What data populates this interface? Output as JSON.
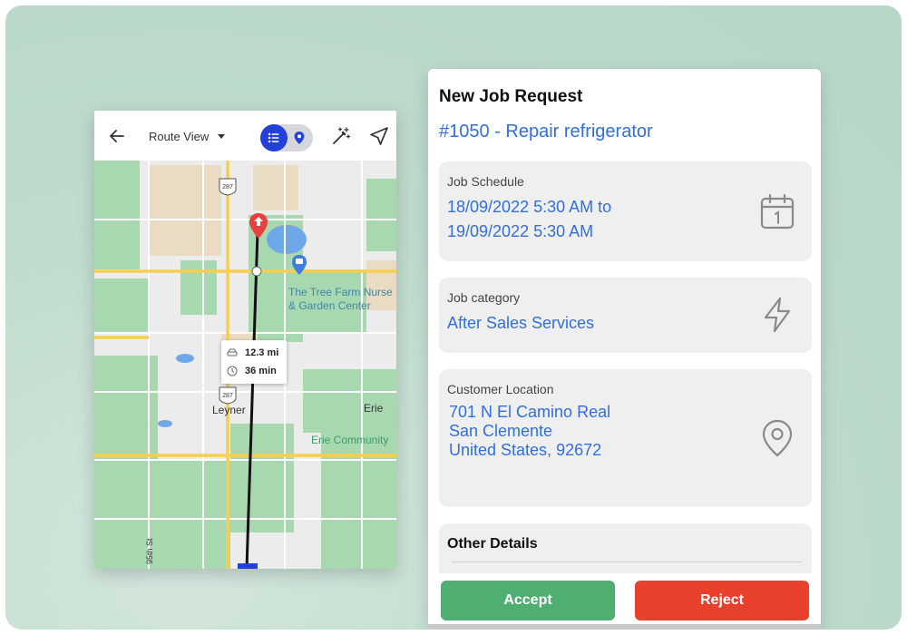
{
  "map_card": {
    "view_select": "Route View",
    "map": {
      "shield_top": "287",
      "shield_mid": "287",
      "poi_name_line1": "The Tree Farm Nurse",
      "poi_name_line2": "& Garden Center",
      "town_leyner": "Leyner",
      "town_erie": "Erie",
      "poi_erie": "Erie Community",
      "street_label": "95th St",
      "route_distance": "12.3 mi",
      "route_time": "36 min"
    }
  },
  "job_panel": {
    "title": "New Job Request",
    "job_number": "#1050 - Repair refrigerator",
    "schedule": {
      "label": "Job Schedule",
      "line1": "18/09/2022 5:30 AM to",
      "line2": "19/09/2022 5:30 AM",
      "icon": "calendar-icon"
    },
    "category": {
      "label": "Job category",
      "value": "After Sales Services",
      "icon": "lightning-icon"
    },
    "location": {
      "label": "Customer Location",
      "line1": "701 N El Camino Real",
      "line2": "San Clemente",
      "line3": "United States, 92672",
      "icon": "location-pin-icon"
    },
    "other_details": "Other Details",
    "accept_label": "Accept",
    "reject_label": "Reject"
  },
  "colors": {
    "background": "#bfdbcd",
    "accent_blue": "#2f6fe0",
    "toggle_blue": "#2340d8",
    "accept_green": "#4fae72",
    "reject_red": "#e8402a",
    "map_green": "#a8d8b0",
    "map_road": "#f6cf4e"
  }
}
